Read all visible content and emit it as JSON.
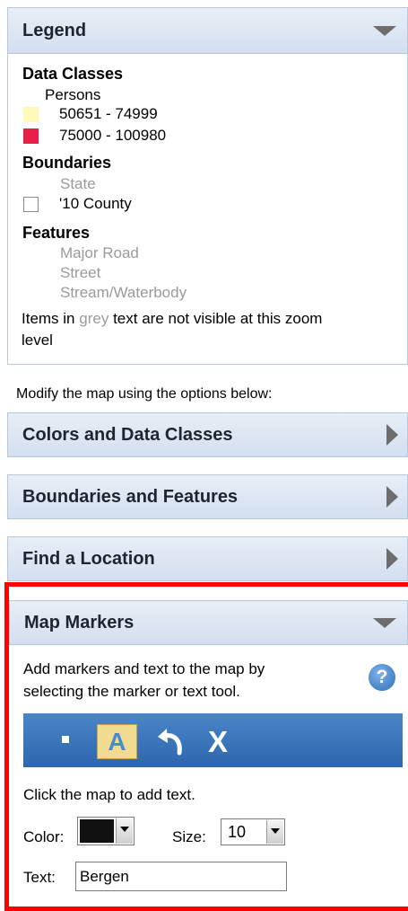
{
  "legend": {
    "title": "Legend",
    "data_classes_heading": "Data Classes",
    "data_classes_field": "Persons",
    "classes": [
      {
        "label": "50651 - 74999",
        "color": "#fdf9b6"
      },
      {
        "label": "75000 - 100980",
        "color": "#e8204a"
      }
    ],
    "boundaries_heading": "Boundaries",
    "boundaries": {
      "state": "State",
      "county": "'10 County"
    },
    "features_heading": "Features",
    "features": [
      "Major Road",
      "Street",
      "Stream/Waterbody"
    ],
    "note_prefix": "Items in",
    "note_grey": "grey",
    "note_suffix": "text are not visible at this zoom",
    "note_line2": "level"
  },
  "modify_text": "Modify the map using the options below:",
  "sections": {
    "colors": "Colors and Data Classes",
    "boundaries": "Boundaries and Features",
    "find": "Find a Location",
    "markers": "Map Markers"
  },
  "markers": {
    "description_line1": "Add markers and text to the map by",
    "description_line2": "selecting the marker or text tool.",
    "help_symbol": "?",
    "tools": {
      "marker": "marker-tool",
      "text": "A",
      "undo": "undo-tool",
      "clear": "X"
    },
    "instruction": "Click the map to add text.",
    "color_label": "Color:",
    "color_value": "#111111",
    "size_label": "Size:",
    "size_value": "10",
    "text_label": "Text:",
    "text_value": "Bergen"
  }
}
